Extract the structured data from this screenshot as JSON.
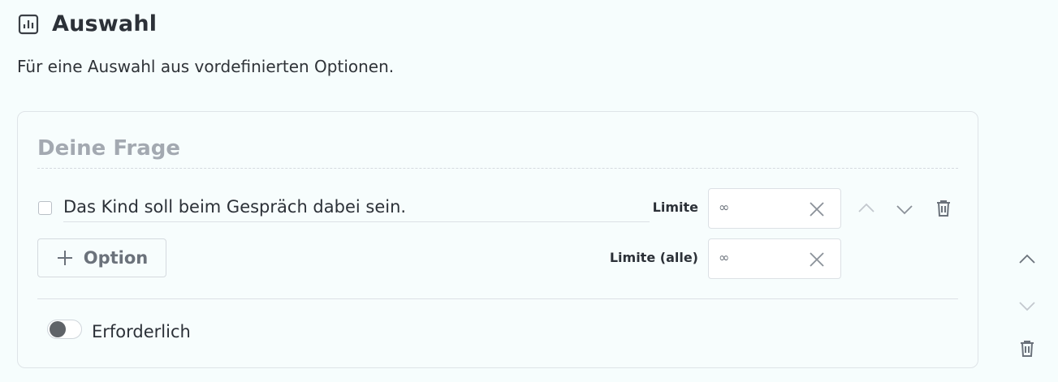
{
  "section": {
    "title": "Auswahl",
    "icon": "bar-chart-icon",
    "description": "Für eine Auswahl aus vordefinierten Optionen."
  },
  "question": {
    "placeholder": "Deine Frage"
  },
  "options": [
    {
      "text": "Das Kind soll beim Gespräch dabei sein.",
      "checked": false,
      "limit_label": "Limite",
      "limit_value": "∞"
    }
  ],
  "add_option_label": "Option",
  "limit_all": {
    "label": "Limite (alle)",
    "value": "∞"
  },
  "required": {
    "label": "Erforderlich",
    "enabled": false
  },
  "colors": {
    "background": "#f6fdfd",
    "text": "#2c3138",
    "muted": "#a3a9b1",
    "icon": "#6b727b",
    "toggle_knob": "#5f6368"
  }
}
